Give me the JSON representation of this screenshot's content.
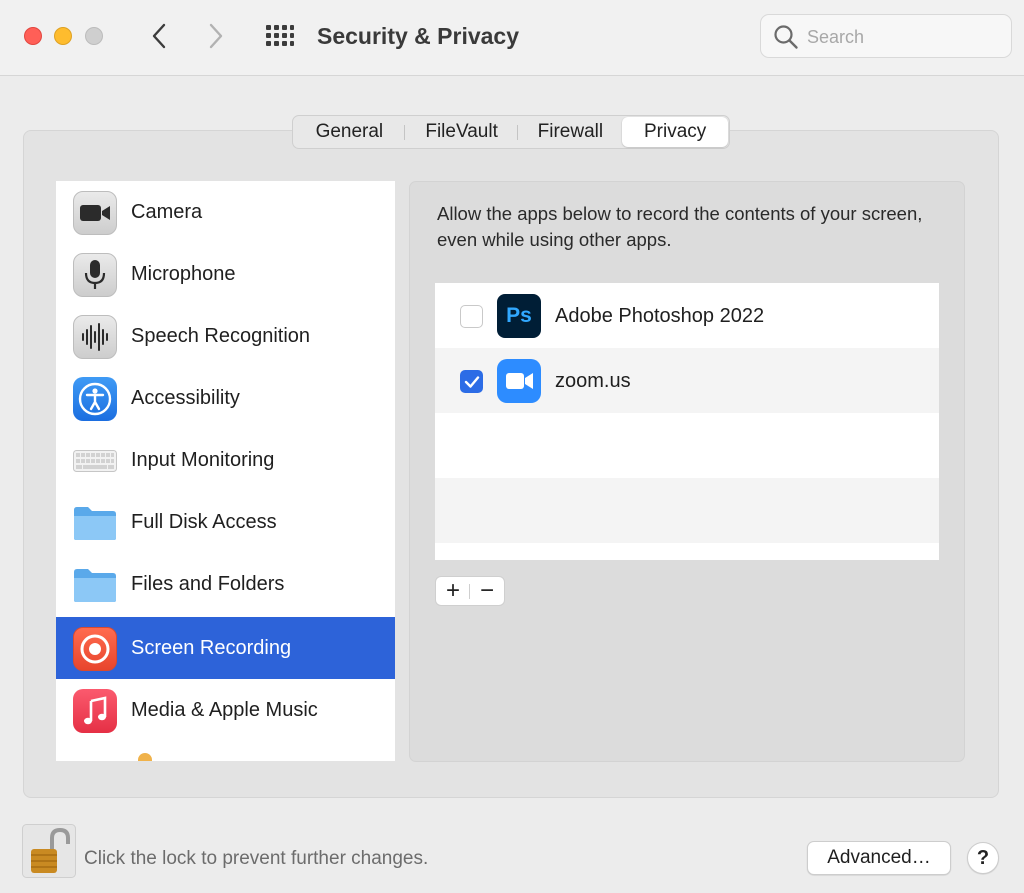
{
  "window": {
    "title": "Security & Privacy"
  },
  "search": {
    "placeholder": "Search",
    "value": ""
  },
  "tabs": [
    {
      "label": "General",
      "active": false
    },
    {
      "label": "FileVault",
      "active": false
    },
    {
      "label": "Firewall",
      "active": false
    },
    {
      "label": "Privacy",
      "active": true
    }
  ],
  "sidebar": {
    "items": [
      {
        "label": "Camera",
        "icon": "camera-icon"
      },
      {
        "label": "Microphone",
        "icon": "microphone-icon"
      },
      {
        "label": "Speech Recognition",
        "icon": "waveform-icon"
      },
      {
        "label": "Accessibility",
        "icon": "accessibility-icon"
      },
      {
        "label": "Input Monitoring",
        "icon": "keyboard-icon"
      },
      {
        "label": "Full Disk Access",
        "icon": "folder-icon"
      },
      {
        "label": "Files and Folders",
        "icon": "folder-icon"
      },
      {
        "label": "Screen Recording",
        "icon": "record-icon",
        "selected": true
      },
      {
        "label": "Media & Apple Music",
        "icon": "music-note-icon"
      }
    ]
  },
  "content": {
    "description": "Allow the apps below to record the contents of your screen, even while using other apps.",
    "apps": [
      {
        "name": "Adobe Photoshop 2022",
        "icon": "photoshop-icon",
        "icon_text": "Ps",
        "checked": false
      },
      {
        "name": "zoom.us",
        "icon": "zoom-icon",
        "checked": true
      }
    ],
    "add_symbol": "+",
    "remove_symbol": "−"
  },
  "footer": {
    "lock_text": "Click the lock to prevent further changes.",
    "advanced_label": "Advanced…",
    "help_label": "?"
  },
  "colors": {
    "selection": "#2d63d9",
    "checkbox_on": "#2c6ce6",
    "close": "#ff5f57",
    "minimize": "#febc2e"
  }
}
